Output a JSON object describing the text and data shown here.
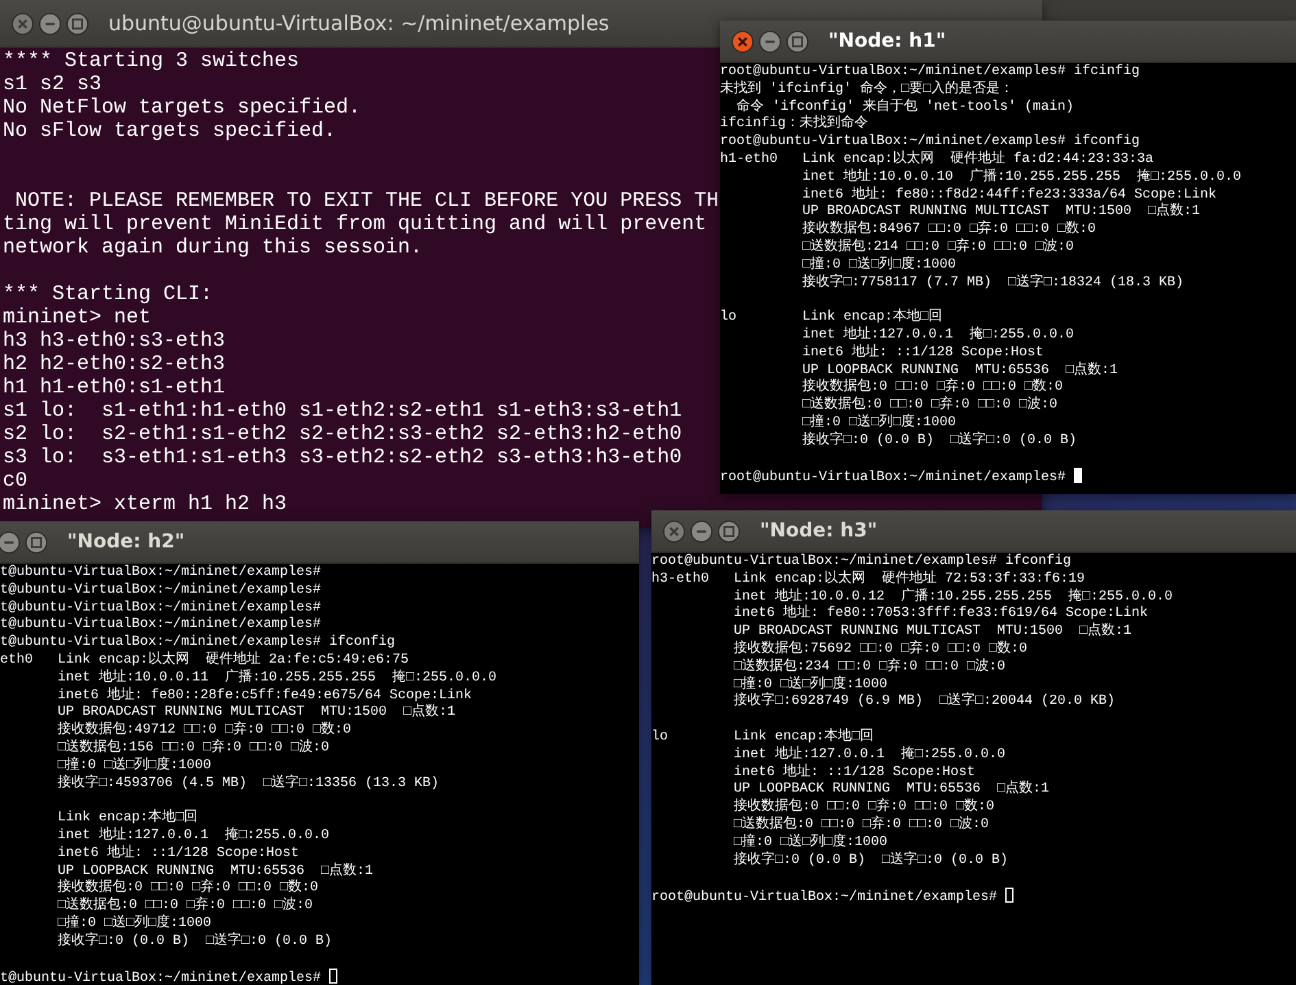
{
  "windows": [
    {
      "kind": "terminal",
      "title": "ubuntu@ubuntu-VirtualBox: ~/mininet/examples",
      "focused": false,
      "blocks": [
        {
          "lines": [
            "**** Starting 3 switches",
            "s1 s2 s3",
            "No NetFlow targets specified.",
            "No sFlow targets specified."
          ]
        },
        {
          "lines": [
            " NOTE: PLEASE REMEMBER TO EXIT THE CLI BEFORE YOU PRESS TH",
            "ting will prevent MiniEdit from quitting and will prevent",
            "network again during this sessoin."
          ]
        },
        {
          "lines": [
            "*** Starting CLI:",
            "mininet> net",
            "h3 h3-eth0:s3-eth3",
            "h2 h2-eth0:s2-eth3",
            "h1 h1-eth0:s1-eth1",
            "s1 lo:  s1-eth1:h1-eth0 s1-eth2:s2-eth1 s1-eth3:s3-eth1",
            "s2 lo:  s2-eth1:s1-eth2 s2-eth2:s3-eth2 s2-eth3:h2-eth0",
            "s3 lo:  s3-eth1:s1-eth3 s3-eth2:s2-eth2 s3-eth3:h3-eth0",
            "c0",
            "mininet> xterm h1 h2 h3"
          ]
        }
      ]
    },
    {
      "kind": "xterm",
      "title": "\"Node: h1\"",
      "focused": true,
      "prompt": "root@ubuntu-VirtualBox:~/mininet/examples# ",
      "blocks": [
        {
          "lines": [
            "root@ubuntu-VirtualBox:~/mininet/examples# ifcinfig",
            "未找到 'ifcinfig' 命令，□要□入的是否是：",
            "  命令 'ifconfig' 来自于包 'net-tools' (main)",
            "ifcinfig：未找到命令",
            "root@ubuntu-VirtualBox:~/mininet/examples# ifconfig",
            "h1-eth0   Link encap:以太网  硬件地址 fa:d2:44:23:33:3a",
            "          inet 地址:10.0.0.10  广播:10.255.255.255  掩□:255.0.0.0",
            "          inet6 地址: fe80::f8d2:44ff:fe23:333a/64 Scope:Link",
            "          UP BROADCAST RUNNING MULTICAST  MTU:1500  □点数:1",
            "          接收数据包:84967 □□:0 □弃:0 □□:0 □数:0",
            "          □送数据包:214 □□:0 □弃:0 □□:0 □波:0",
            "          □撞:0 □送□列□度:1000",
            "          接收字□:7758117 (7.7 MB)  □送字□:18324 (18.3 KB)"
          ]
        },
        {
          "lines": [
            "lo        Link encap:本地□回",
            "          inet 地址:127.0.0.1  掩□:255.0.0.0",
            "          inet6 地址: ::1/128 Scope:Host",
            "          UP LOOPBACK RUNNING  MTU:65536  □点数:1",
            "          接收数据包:0 □□:0 □弃:0 □□:0 □数:0",
            "          □送数据包:0 □□:0 □弃:0 □□:0 □波:0",
            "          □撞:0 □送□列□度:1000",
            "          接收字□:0 (0.0 B)  □送字□:0 (0.0 B)"
          ]
        }
      ]
    },
    {
      "kind": "xterm",
      "title": "\"Node: h2\"",
      "focused": false,
      "prompt": "t@ubuntu-VirtualBox:~/mininet/examples# ",
      "blocks": [
        {
          "lines": [
            "t@ubuntu-VirtualBox:~/mininet/examples#",
            "t@ubuntu-VirtualBox:~/mininet/examples#",
            "t@ubuntu-VirtualBox:~/mininet/examples#",
            "t@ubuntu-VirtualBox:~/mininet/examples#",
            "t@ubuntu-VirtualBox:~/mininet/examples# ifconfig",
            "eth0   Link encap:以太网  硬件地址 2a:fe:c5:49:e6:75",
            "       inet 地址:10.0.0.11  广播:10.255.255.255  掩□:255.0.0.0",
            "       inet6 地址: fe80::28fe:c5ff:fe49:e675/64 Scope:Link",
            "       UP BROADCAST RUNNING MULTICAST  MTU:1500  □点数:1",
            "       接收数据包:49712 □□:0 □弃:0 □□:0 □数:0",
            "       □送数据包:156 □□:0 □弃:0 □□:0 □波:0",
            "       □撞:0 □送□列□度:1000",
            "       接收字□:4593706 (4.5 MB)  □送字□:13356 (13.3 KB)"
          ]
        },
        {
          "lines": [
            "       Link encap:本地□回",
            "       inet 地址:127.0.0.1  掩□:255.0.0.0",
            "       inet6 地址: ::1/128 Scope:Host",
            "       UP LOOPBACK RUNNING  MTU:65536  □点数:1",
            "       接收数据包:0 □□:0 □弃:0 □□:0 □数:0",
            "       □送数据包:0 □□:0 □弃:0 □□:0 □波:0",
            "       □撞:0 □送□列□度:1000",
            "       接收字□:0 (0.0 B)  □送字□:0 (0.0 B)"
          ]
        }
      ]
    },
    {
      "kind": "xterm",
      "title": "\"Node: h3\"",
      "focused": false,
      "prompt": "root@ubuntu-VirtualBox:~/mininet/examples# ",
      "blocks": [
        {
          "lines": [
            "root@ubuntu-VirtualBox:~/mininet/examples# ifconfig",
            "h3-eth0   Link encap:以太网  硬件地址 72:53:3f:33:f6:19",
            "          inet 地址:10.0.0.12  广播:10.255.255.255  掩□:255.0.0.0",
            "          inet6 地址: fe80::7053:3fff:fe33:f619/64 Scope:Link",
            "          UP BROADCAST RUNNING MULTICAST  MTU:1500  □点数:1",
            "          接收数据包:75692 □□:0 □弃:0 □□:0 □数:0",
            "          □送数据包:234 □□:0 □弃:0 □□:0 □波:0",
            "          □撞:0 □送□列□度:1000",
            "          接收字□:6928749 (6.9 MB)  □送字□:20044 (20.0 KB)"
          ]
        },
        {
          "lines": [
            "lo        Link encap:本地□回",
            "          inet 地址:127.0.0.1  掩□:255.0.0.0",
            "          inet6 地址: ::1/128 Scope:Host",
            "          UP LOOPBACK RUNNING  MTU:65536  □点数:1",
            "          接收数据包:0 □□:0 □弃:0 □□:0 □数:0",
            "          □送数据包:0 □□:0 □弃:0 □□:0 □波:0",
            "          □撞:0 □送□列□度:1000",
            "          接收字□:0 (0.0 B)  □送字□:0 (0.0 B)"
          ]
        }
      ]
    }
  ]
}
